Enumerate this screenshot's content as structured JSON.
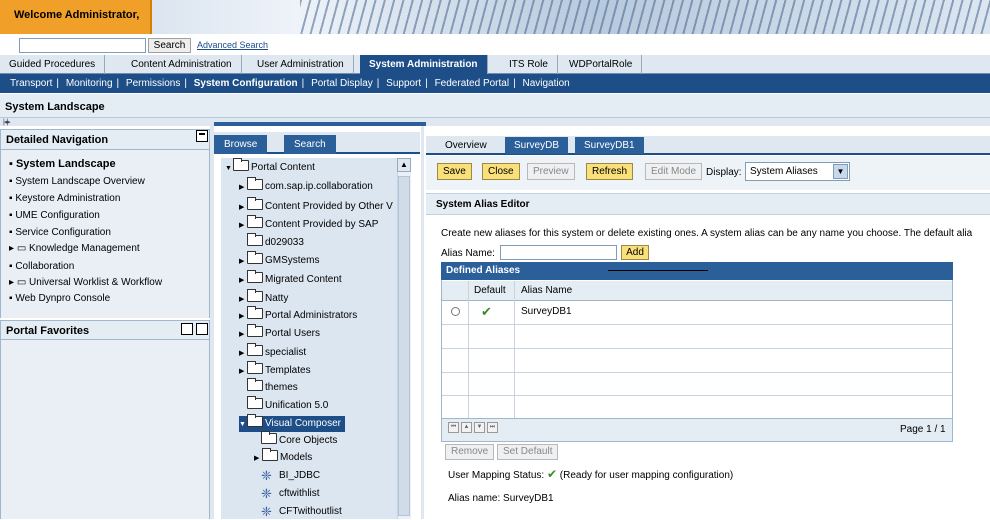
{
  "header": {
    "welcome": "Welcome Administrator,"
  },
  "search": {
    "button": "Search",
    "advanced_link": "Advanced Search",
    "value": ""
  },
  "top_nav": [
    {
      "label": "Guided Procedures",
      "active": false
    },
    {
      "label": "Content Administration",
      "active": false
    },
    {
      "label": "User Administration",
      "active": false
    },
    {
      "label": "System Administration",
      "active": true
    },
    {
      "label": "ITS Role",
      "active": false
    },
    {
      "label": "WDPortalRole",
      "active": false
    }
  ],
  "sub_nav": [
    "Transport",
    "Monitoring",
    "Permissions",
    "System Configuration",
    "Portal Display",
    "Support",
    "Federated Portal",
    "Navigation"
  ],
  "sub_nav_active": "System Configuration",
  "page_title": "System Landscape",
  "detailed_nav": {
    "title": "Detailed Navigation",
    "items": [
      "System Landscape",
      "System Landscape Overview",
      "Keystore Administration",
      "UME Configuration",
      "Service Configuration",
      "Knowledge Management",
      "Collaboration",
      "Universal Worklist & Workflow",
      "Web Dynpro Console"
    ]
  },
  "portal_favorites": {
    "title": "Portal Favorites"
  },
  "browse": {
    "tabs": [
      "Browse",
      "Search"
    ],
    "tree": [
      "Portal Content",
      "com.sap.ip.collaboration",
      "Content Provided by Other V",
      "Content Provided by SAP",
      "d029033",
      "GMSystems",
      "Migrated Content",
      "Natty",
      "Portal Administrators",
      "Portal Users",
      "specialist",
      "Templates",
      "themes",
      "Unification 5.0",
      "Visual Composer",
      "Core Objects",
      "Models",
      "BI_JDBC",
      "cftwithlist",
      "CFTwithoutlist"
    ]
  },
  "content": {
    "tabs": [
      "Overview",
      "SurveyDB",
      "SurveyDB1"
    ],
    "toolbar": {
      "save": "Save",
      "close": "Close",
      "preview": "Preview",
      "refresh": "Refresh",
      "edit_mode": "Edit Mode",
      "display_label": "Display:",
      "display_value": "System Aliases"
    },
    "editor_title": "System Alias Editor",
    "description": "Create new aliases for this system or delete existing ones. A system alias can be any name you choose. The default alia",
    "alias_label": "Alias Name:",
    "add_button": "Add",
    "table": {
      "title": "Defined Aliases",
      "columns": [
        "Default",
        "Alias Name"
      ],
      "rows": [
        {
          "alias": "SurveyDB1",
          "default": true
        }
      ],
      "page_info": "Page 1 / 1"
    },
    "remove_button": "Remove",
    "set_default_button": "Set Default",
    "user_mapping_label": "User Mapping Status:",
    "user_mapping_value": "(Ready for user mapping configuration)",
    "alias_name_line": "Alias name: SurveyDB1"
  }
}
